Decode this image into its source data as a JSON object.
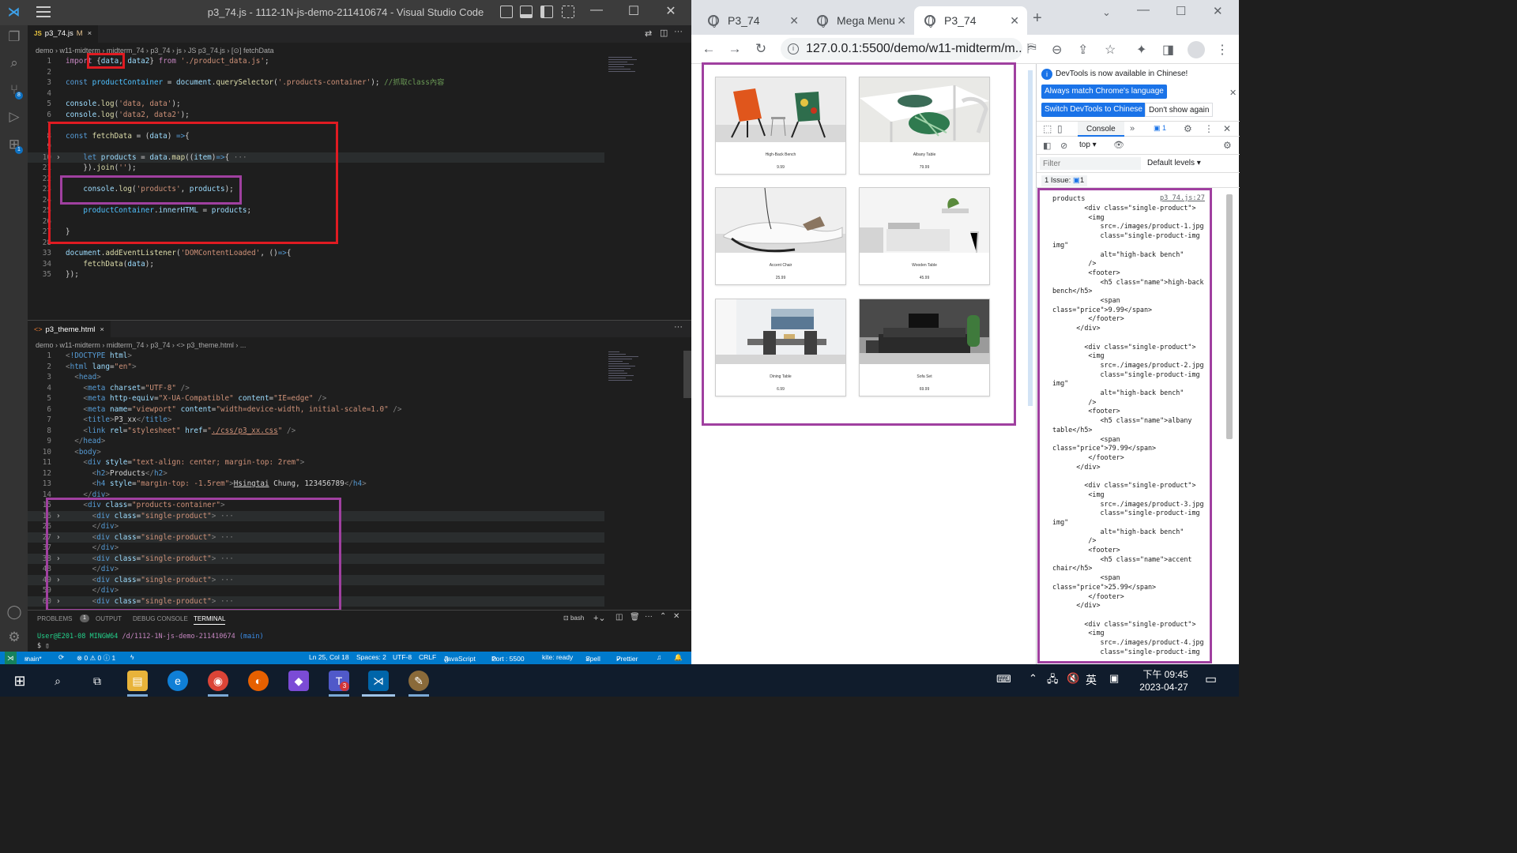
{
  "vscode": {
    "title": "p3_74.js - 1112-1N-js-demo-211410674 - Visual Studio Code",
    "editor1": {
      "tab": {
        "icon": "JS",
        "name": "p3_74.js",
        "modified": "M",
        "close": "×"
      },
      "breadcrumb": "demo › w11-midterm › midterm_74 › p3_74 › js › JS p3_74.js › [⊙] fetchData",
      "lines": [
        {
          "n": "1",
          "html": "<span class='kc'>import</span> {<span class='vr'>data</span>, <span class='vr'>data2</span>} <span class='kc'>from</span> <span class='st'>'./product_data.js'</span>;"
        },
        {
          "n": "2",
          "html": ""
        },
        {
          "n": "3",
          "html": "<span class='kw'>const</span> <span class='cn'>productContainer</span> = <span class='vr'>document</span>.<span class='fn'>querySelector</span>(<span class='st'>'.products-container'</span>); <span class='cm'>//抓取class內容</span>"
        },
        {
          "n": "4",
          "html": ""
        },
        {
          "n": "5",
          "html": "<span class='vr'>console</span>.<span class='fn'>log</span>(<span class='st'>'data, data'</span>);"
        },
        {
          "n": "6",
          "html": "<span class='vr'>console</span>.<span class='fn'>log</span>(<span class='st'>'data2, data2'</span>);"
        },
        {
          "n": "7",
          "html": ""
        },
        {
          "n": "8",
          "html": "<span class='kw'>const</span> <span class='fn'>fetchData</span> = (<span class='vr'>data</span>) <span class='kw'>=&gt;</span>{"
        },
        {
          "n": "9",
          "html": ""
        },
        {
          "n": "10",
          "html": "    <span class='kw'>let</span> <span class='vr'>products</span> = <span class='vr'>data</span>.<span class='fn'>map</span>((<span class='vr'>item</span>)<span class='kw'>=&gt;</span>{ <span class='pn'>···</span>",
          "fold": true
        },
        {
          "n": "21",
          "html": "    }).<span class='fn'>join</span>(<span class='st'>''</span>);"
        },
        {
          "n": "22",
          "html": ""
        },
        {
          "n": "23",
          "html": "    <span class='vr'>console</span>.<span class='fn'>log</span>(<span class='st'>'products'</span>, <span class='vr'>products</span>);"
        },
        {
          "n": "24",
          "html": ""
        },
        {
          "n": "25",
          "html": "    <span class='cn'>productContainer</span>.<span class='vr'>innerHTML</span> = <span class='vr'>products</span>;"
        },
        {
          "n": "26",
          "html": ""
        },
        {
          "n": "27",
          "html": "}"
        },
        {
          "n": "28",
          "html": ""
        },
        {
          "n": "33",
          "html": "<span class='vr'>document</span>.<span class='fn'>addEventListener</span>(<span class='st'>'DOMContentLoaded'</span>, ()<span class='kw'>=&gt;</span>{"
        },
        {
          "n": "34",
          "html": "    <span class='fn'>fetchData</span>(<span class='vr'>data</span>);"
        },
        {
          "n": "35",
          "html": "});"
        }
      ]
    },
    "editor2": {
      "tab": {
        "icon": "<>",
        "name": "p3_theme.html",
        "close": "×"
      },
      "breadcrumb": "demo › w11-midterm › midterm_74 › p3_74 › <> p3_theme.html › ...",
      "lines": [
        {
          "n": "1",
          "html": "<span class='pn'>&lt;</span><span class='tg'>!DOCTYPE</span> <span class='at'>html</span><span class='pn'>&gt;</span>"
        },
        {
          "n": "2",
          "html": "<span class='pn'>&lt;</span><span class='tg'>html</span> <span class='at'>lang</span>=<span class='av'>\"en\"</span><span class='pn'>&gt;</span>"
        },
        {
          "n": "3",
          "html": "  <span class='pn'>&lt;</span><span class='tg'>head</span><span class='pn'>&gt;</span>"
        },
        {
          "n": "4",
          "html": "    <span class='pn'>&lt;</span><span class='tg'>meta</span> <span class='at'>charset</span>=<span class='av'>\"UTF-8\"</span> <span class='pn'>/&gt;</span>"
        },
        {
          "n": "5",
          "html": "    <span class='pn'>&lt;</span><span class='tg'>meta</span> <span class='at'>http-equiv</span>=<span class='av'>\"X-UA-Compatible\"</span> <span class='at'>content</span>=<span class='av'>\"IE=edge\"</span> <span class='pn'>/&gt;</span>"
        },
        {
          "n": "6",
          "html": "    <span class='pn'>&lt;</span><span class='tg'>meta</span> <span class='at'>name</span>=<span class='av'>\"viewport\"</span> <span class='at'>content</span>=<span class='av'>\"width=device-width, initial-scale=1.0\"</span> <span class='pn'>/&gt;</span>"
        },
        {
          "n": "7",
          "html": "    <span class='pn'>&lt;</span><span class='tg'>title</span><span class='pn'>&gt;</span>P3_xx<span class='pn'>&lt;/</span><span class='tg'>title</span><span class='pn'>&gt;</span>"
        },
        {
          "n": "8",
          "html": "    <span class='pn'>&lt;</span><span class='tg'>link</span> <span class='at'>rel</span>=<span class='av'>\"stylesheet\"</span> <span class='at'>href</span>=<span class='av'>\"<u>./css/p3_xx.css</u>\"</span> <span class='pn'>/&gt;</span>"
        },
        {
          "n": "9",
          "html": "  <span class='pn'>&lt;/</span><span class='tg'>head</span><span class='pn'>&gt;</span>"
        },
        {
          "n": "10",
          "html": "  <span class='pn'>&lt;</span><span class='tg'>body</span><span class='pn'>&gt;</span>"
        },
        {
          "n": "11",
          "html": "    <span class='pn'>&lt;</span><span class='tg'>div</span> <span class='at'>style</span>=<span class='av'>\"text-align: center; margin-top: 2rem\"</span><span class='pn'>&gt;</span>"
        },
        {
          "n": "12",
          "html": "      <span class='pn'>&lt;</span><span class='tg'>h2</span><span class='pn'>&gt;</span>Products<span class='pn'>&lt;/</span><span class='tg'>h2</span><span class='pn'>&gt;</span>"
        },
        {
          "n": "13",
          "html": "      <span class='pn'>&lt;</span><span class='tg'>h4</span> <span class='at'>style</span>=<span class='av'>\"margin-top: -1.5rem\"</span><span class='pn'>&gt;</span><u>Hsingtai</u> Chung, 123456789<span class='pn'>&lt;/</span><span class='tg'>h4</span><span class='pn'>&gt;</span>"
        },
        {
          "n": "14",
          "html": "    <span class='pn'>&lt;/</span><span class='tg'>div</span><span class='pn'>&gt;</span>"
        },
        {
          "n": "15",
          "html": "    <span class='pn'>&lt;</span><span class='tg'>div</span> <span class='at'>class</span>=<span class='av'>\"products-container\"</span><span class='pn'>&gt;</span>"
        },
        {
          "n": "16",
          "html": "      <span class='pn'>&lt;</span><span class='tg'>div</span> <span class='at'>class</span>=<span class='av'>\"single-product\"</span><span class='pn'>&gt;</span> <span class='pn'>···</span>",
          "fold": true
        },
        {
          "n": "26",
          "html": "      <span class='pn'>&lt;/</span><span class='tg'>div</span><span class='pn'>&gt;</span>"
        },
        {
          "n": "27",
          "html": "      <span class='pn'>&lt;</span><span class='tg'>div</span> <span class='at'>class</span>=<span class='av'>\"single-product\"</span><span class='pn'>&gt;</span> <span class='pn'>···</span>",
          "fold": true
        },
        {
          "n": "37",
          "html": "      <span class='pn'>&lt;/</span><span class='tg'>div</span><span class='pn'>&gt;</span>"
        },
        {
          "n": "38",
          "html": "      <span class='pn'>&lt;</span><span class='tg'>div</span> <span class='at'>class</span>=<span class='av'>\"single-product\"</span><span class='pn'>&gt;</span> <span class='pn'>···</span>",
          "fold": true
        },
        {
          "n": "48",
          "html": "      <span class='pn'>&lt;/</span><span class='tg'>div</span><span class='pn'>&gt;</span>"
        },
        {
          "n": "49",
          "html": "      <span class='pn'>&lt;</span><span class='tg'>div</span> <span class='at'>class</span>=<span class='av'>\"single-product\"</span><span class='pn'>&gt;</span> <span class='pn'>···</span>",
          "fold": true
        },
        {
          "n": "59",
          "html": "      <span class='pn'>&lt;/</span><span class='tg'>div</span><span class='pn'>&gt;</span>"
        },
        {
          "n": "60",
          "html": "      <span class='pn'>&lt;</span><span class='tg'>div</span> <span class='at'>class</span>=<span class='av'>\"single-product\"</span><span class='pn'>&gt;</span> <span class='pn'>···</span>",
          "fold": true
        }
      ]
    },
    "panel": {
      "tabs": [
        "PROBLEMS",
        "OUTPUT",
        "DEBUG CONSOLE",
        "TERMINAL"
      ],
      "problems_count": "1",
      "shell": "bash",
      "prompt_user": "User@E201-08 MINGW64",
      "prompt_path": "/d/1112-1N-js-demo-211410674",
      "prompt_branch": "(main)",
      "prompt_symbol": "$"
    },
    "status": {
      "branch": "main*",
      "problems": "⊗ 0 ⚠ 0 ⓘ 1",
      "position": "Ln 25, Col 18",
      "spaces": "Spaces: 2",
      "encoding": "UTF-8",
      "eol": "CRLF",
      "language": "JavaScript",
      "port": "Port : 5500",
      "kite": "kite: ready",
      "spell": "Spell",
      "prettier": "Prettier"
    }
  },
  "chrome": {
    "tabs": [
      {
        "title": "P3_74"
      },
      {
        "title": "Mega Menu"
      },
      {
        "title": "P3_74"
      }
    ],
    "url": "127.0.0.1:5500/demo/w11-midterm/m...",
    "products": [
      {
        "name": "High-Back Bench",
        "price": "9.99"
      },
      {
        "name": "Albany Table",
        "price": "79.99"
      },
      {
        "name": "Accent Chair",
        "price": "25.99"
      },
      {
        "name": "Wooden Table",
        "price": "45.99"
      },
      {
        "name": "Dining Table",
        "price": "6.99"
      },
      {
        "name": "Sofa Set",
        "price": "69.99"
      }
    ],
    "devtools": {
      "notice": "DevTools is now available in Chinese!",
      "btn_match": "Always match Chrome's language",
      "btn_switch": "Switch DevTools to Chinese",
      "btn_dont": "Don't show again",
      "console_tab": "Console",
      "issues_badge": "1",
      "context": "top",
      "filter_placeholder": "Filter",
      "levels": "Default levels",
      "issue_count": "1 Issue:",
      "issue_num": "1",
      "log_label": "products",
      "log_source": "p3_74.js:27",
      "log_text": "        <div class=\"single-product\">\n         <img\n            src=./images/product-1.jpg\n            class=\"single-product-img\nimg\"\n            alt=\"high-back bench\"\n         />\n         <footer>\n            <h5 class=\"name\">high-back\nbench</h5>\n            <span\nclass=\"price\">9.99</span>\n         </footer>\n      </div>\n\n        <div class=\"single-product\">\n         <img\n            src=./images/product-2.jpg\n            class=\"single-product-img\nimg\"\n            alt=\"high-back bench\"\n         />\n         <footer>\n            <h5 class=\"name\">albany\ntable</h5>\n            <span\nclass=\"price\">79.99</span>\n         </footer>\n      </div>\n\n        <div class=\"single-product\">\n         <img\n            src=./images/product-3.jpg\n            class=\"single-product-img\nimg\"\n            alt=\"high-back bench\"\n         />\n         <footer>\n            <h5 class=\"name\">accent\nchair</h5>\n            <span\nclass=\"price\">25.99</span>\n         </footer>\n      </div>\n\n        <div class=\"single-product\">\n         <img\n            src=./images/product-4.jpg\n            class=\"single-product-img"
    }
  },
  "taskbar": {
    "ime": "英",
    "time": "下午 09:45",
    "date": "2023-04-27",
    "teams_badge": "3"
  },
  "colors": {
    "highlight_red": "#e01b22",
    "highlight_purple": "#a040a0",
    "status_blue": "#007acc"
  }
}
